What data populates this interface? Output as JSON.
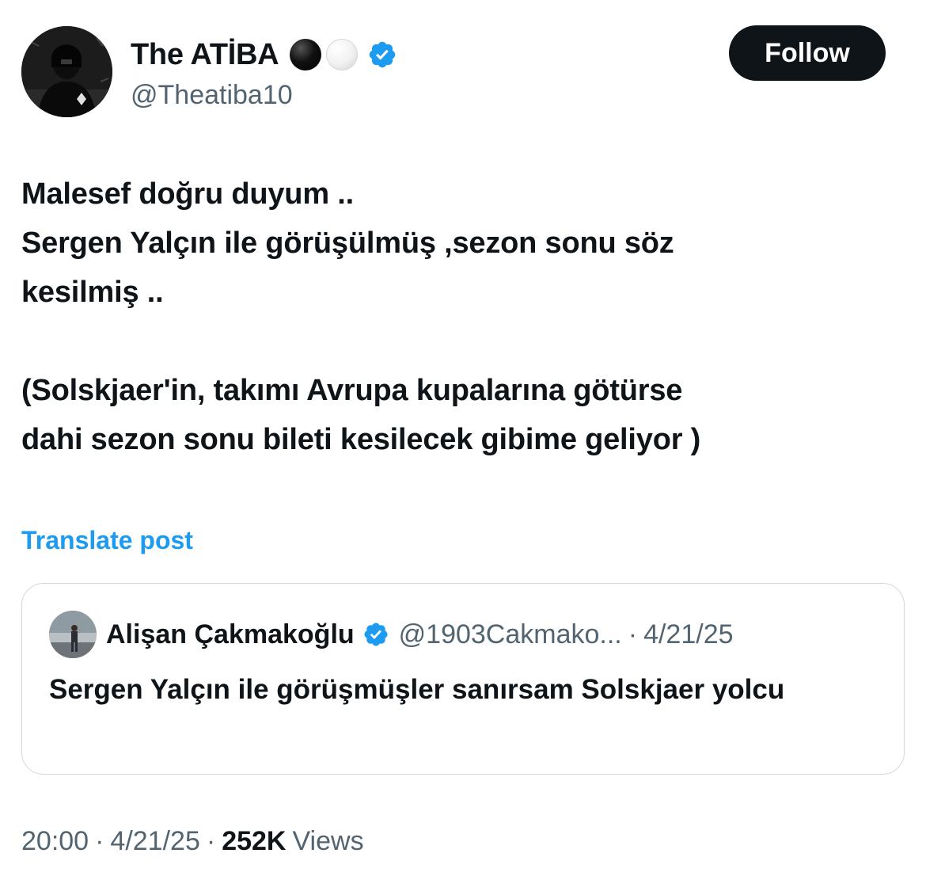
{
  "author": {
    "display_name": "The ATİBA",
    "handle": "@Theatiba10",
    "verified": true,
    "name_emojis": [
      "black-circle",
      "white-circle"
    ]
  },
  "follow_label": "Follow",
  "tweet_text": "Malesef doğru duyum ..\nSergen Yalçın ile görüşülmüş ,sezon sonu söz\nkesilmiş ..\n\n(Solskjaer'in, takımı Avrupa kupalarına götürse\ndahi sezon sonu bileti kesilecek gibime geliyor )",
  "translate_label": "Translate post",
  "quoted_post": {
    "display_name": "Alişan Çakmakoğlu",
    "handle": "@1903Cakmako...",
    "separator": "·",
    "date": "4/21/25",
    "verified": true,
    "text": "Sergen Yalçın ile görüşmüşler sanırsam Solskjaer yolcu"
  },
  "meta": {
    "time": "20:00",
    "separator": "·",
    "date": "4/21/25",
    "views_count": "252K",
    "views_label": "Views"
  },
  "colors": {
    "text_primary": "#0f1419",
    "text_secondary": "#536471",
    "accent_blue": "#1d9bf0",
    "follow_bg": "#0f1419",
    "border": "#cfd9de"
  }
}
